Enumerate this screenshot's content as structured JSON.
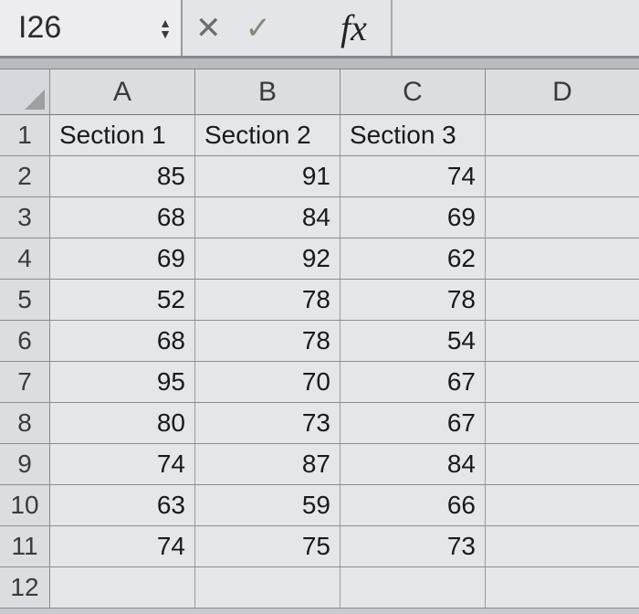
{
  "formula_bar": {
    "name_box": "I26",
    "cancel_icon": "✕",
    "confirm_icon": "✓",
    "fx_label": "fx",
    "formula_value": ""
  },
  "columns": [
    "A",
    "B",
    "C",
    "D"
  ],
  "row_numbers": [
    "1",
    "2",
    "3",
    "4",
    "5",
    "6",
    "7",
    "8",
    "9",
    "10",
    "11",
    "12"
  ],
  "headers": [
    "Section 1",
    "Section 2",
    "Section 3"
  ],
  "chart_data": {
    "type": "table",
    "title": "",
    "columns": [
      "Section 1",
      "Section 2",
      "Section 3"
    ],
    "rows": [
      [
        85,
        91,
        74
      ],
      [
        68,
        84,
        69
      ],
      [
        69,
        92,
        62
      ],
      [
        52,
        78,
        78
      ],
      [
        68,
        78,
        54
      ],
      [
        95,
        70,
        67
      ],
      [
        80,
        73,
        67
      ],
      [
        74,
        87,
        84
      ],
      [
        63,
        59,
        66
      ],
      [
        74,
        75,
        73
      ]
    ]
  }
}
